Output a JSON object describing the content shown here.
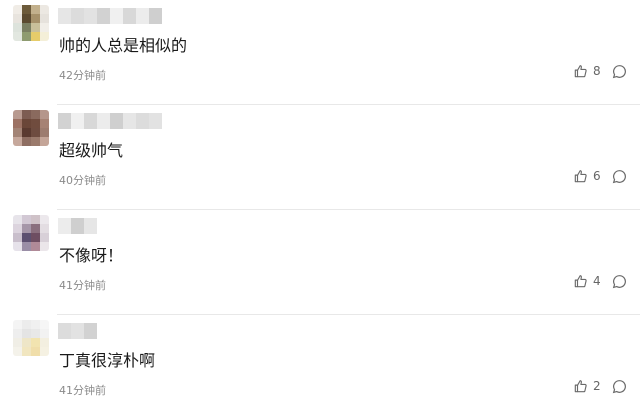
{
  "comments": [
    {
      "content": "帅的人总是相似的",
      "time": "42分钟前",
      "likes": "8",
      "like_icon": "thumbs-up-icon",
      "reply_icon": "comment-bubble-icon",
      "avatar_palette": [
        "#f0ece6",
        "#6c5a3a",
        "#c2b08c",
        "#ece8e2",
        "#e8e4de",
        "#5b4a30",
        "#a6916a",
        "#e6e2dc",
        "#dde3dc",
        "#7a7f62",
        "#c9c09a",
        "#f1eee8",
        "#e2e7e0",
        "#8e9b70",
        "#e6cc6a",
        "#f4efd8"
      ]
    },
    {
      "content": "超级帅气",
      "time": "40分钟前",
      "likes": "6",
      "like_icon": "thumbs-up-icon",
      "reply_icon": "comment-bubble-icon",
      "avatar_palette": [
        "#b89a90",
        "#7d5c52",
        "#8a6a5e",
        "#b5968b",
        "#9c7264",
        "#6a4638",
        "#704c3e",
        "#a68274",
        "#a38476",
        "#5a3a30",
        "#6e4c40",
        "#9d7c6f",
        "#c6a89c",
        "#8e6e62",
        "#9a7a6c",
        "#c4a598"
      ]
    },
    {
      "content": "不像呀！",
      "time": "41分钟前",
      "likes": "4",
      "like_icon": "thumbs-up-icon",
      "reply_icon": "comment-bubble-icon",
      "avatar_palette": [
        "#e7e4ea",
        "#d2c8d4",
        "#cfc2c8",
        "#ece8ec",
        "#dcd4de",
        "#a596a8",
        "#8a6f7e",
        "#e3dde2",
        "#c9bfcc",
        "#5c5070",
        "#6e4e62",
        "#d8d0d8",
        "#e6e2ea",
        "#9a8ea6",
        "#b08a98",
        "#ebe6ea"
      ]
    },
    {
      "content": "丁真很淳朴啊",
      "time": "41分钟前",
      "likes": "2",
      "like_icon": "thumbs-up-icon",
      "reply_icon": "comment-bubble-icon",
      "avatar_palette": [
        "#f4f4f4",
        "#ececec",
        "#f0f0f0",
        "#f6f6f6",
        "#eeeeee",
        "#e4e4e4",
        "#e8e8e8",
        "#f2f2f2",
        "#f0eee6",
        "#eee6c8",
        "#f2e4b0",
        "#f3efe0",
        "#f4f2ea",
        "#f1e6c0",
        "#f0deaa",
        "#f5f1e2"
      ]
    }
  ],
  "colors": {
    "text_primary": "#1a1a1a",
    "text_secondary": "#8a8a8a",
    "divider": "#e8e8e8",
    "icon": "#6a6a6a"
  }
}
